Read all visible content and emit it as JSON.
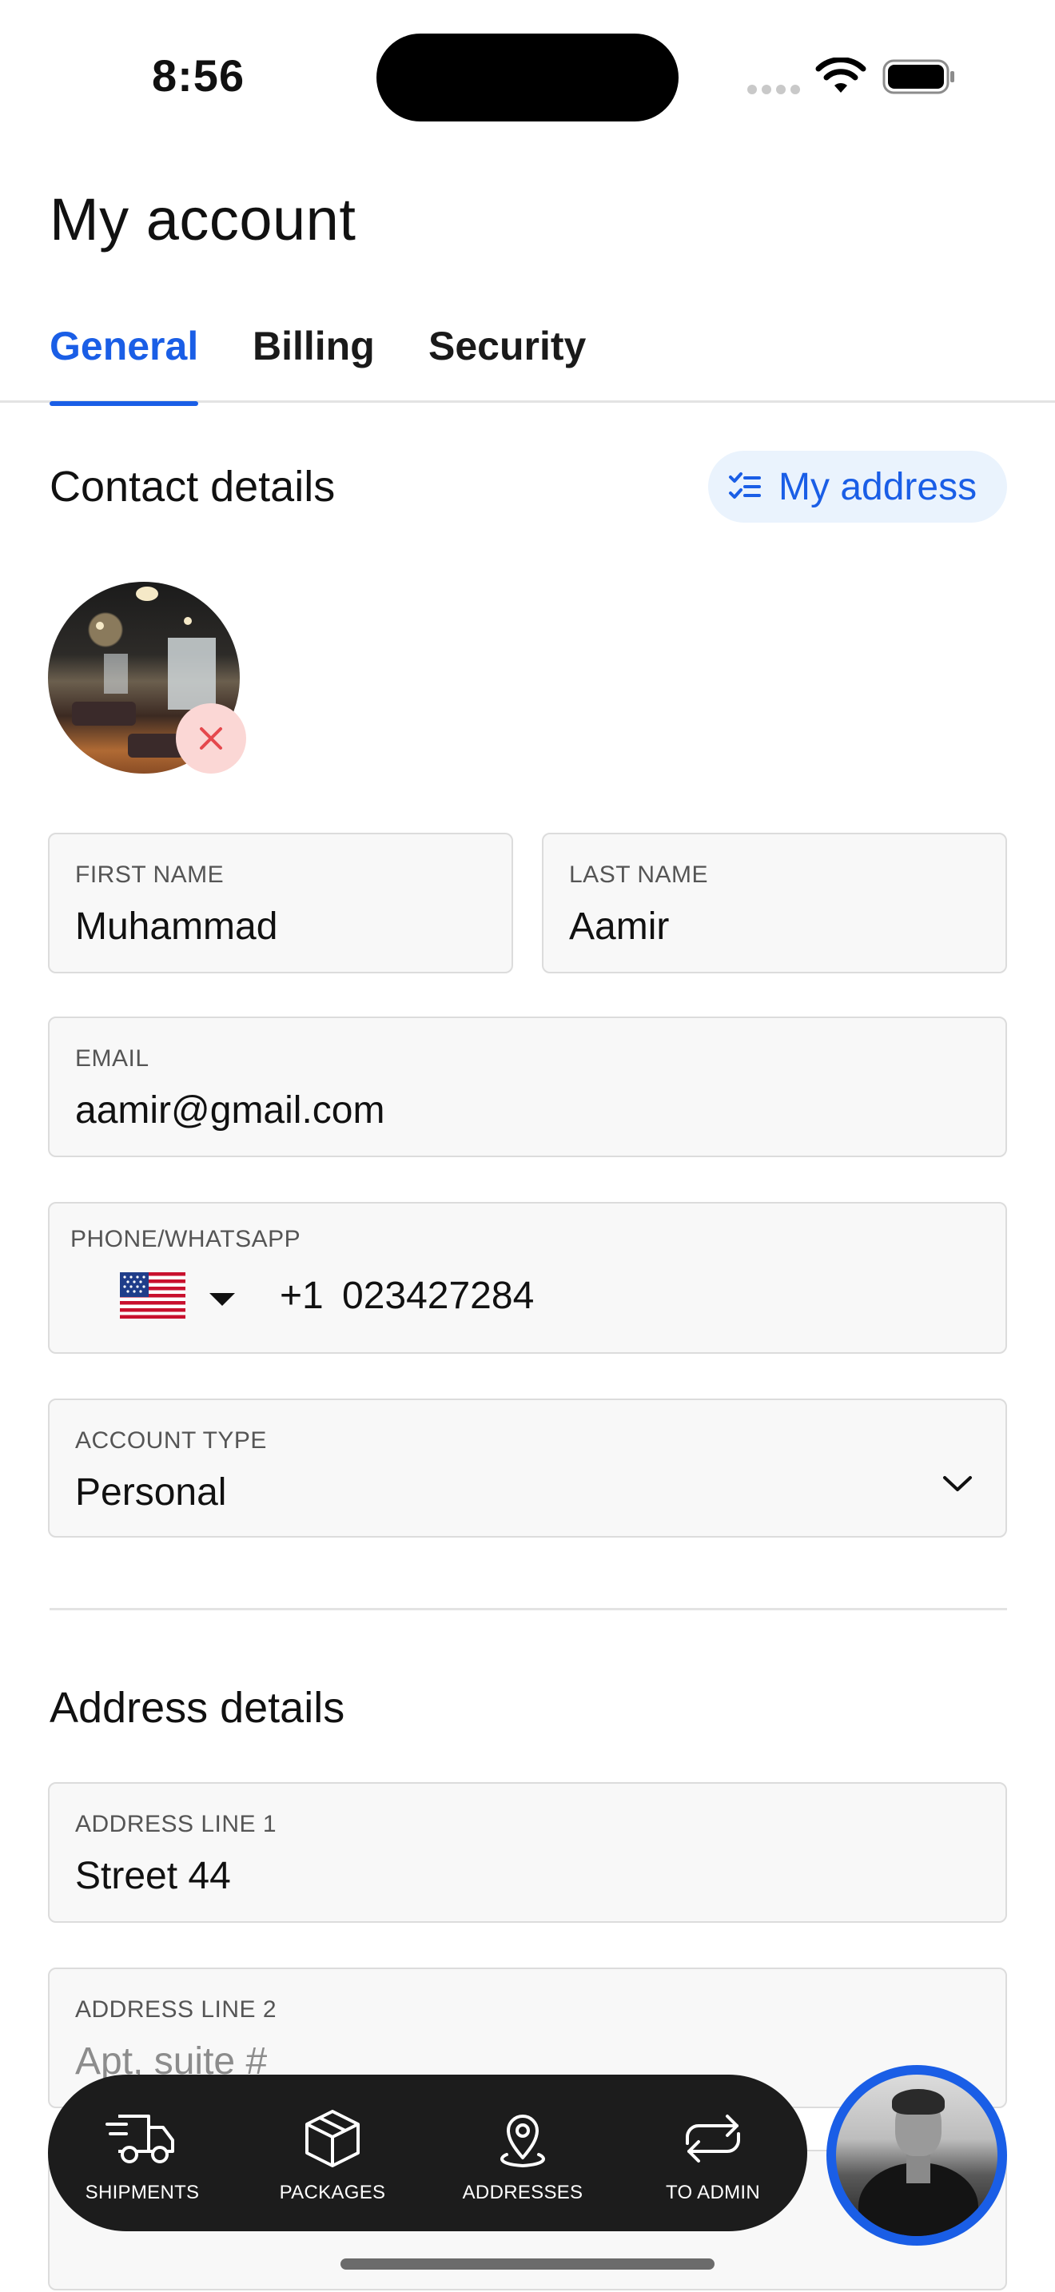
{
  "status_bar": {
    "time": "8:56"
  },
  "header": {
    "title": "My account"
  },
  "tabs": [
    {
      "label": "General",
      "active": true
    },
    {
      "label": "Billing",
      "active": false
    },
    {
      "label": "Security",
      "active": false
    }
  ],
  "contact": {
    "section_title": "Contact details",
    "my_address_label": "My address",
    "first_name": {
      "label": "FIRST NAME",
      "value": "Muhammad"
    },
    "last_name": {
      "label": "LAST NAME",
      "value": "Aamir"
    },
    "email": {
      "label": "EMAIL",
      "value": "aamir@gmail.com"
    },
    "phone": {
      "label": "PHONE/WHATSAPP",
      "country": "US",
      "dial_code": "+1",
      "value": "023427284"
    },
    "account_type": {
      "label": "ACCOUNT TYPE",
      "value": "Personal"
    }
  },
  "address": {
    "section_title": "Address details",
    "line1": {
      "label": "ADDRESS LINE 1",
      "value": "Street 44"
    },
    "line2": {
      "label": "ADDRESS LINE 2",
      "placeholder": "Apt, suite #"
    }
  },
  "bottom_nav": {
    "items": [
      {
        "label": "SHIPMENTS",
        "icon": "truck-icon"
      },
      {
        "label": "PACKAGES",
        "icon": "package-icon"
      },
      {
        "label": "ADDRESSES",
        "icon": "map-pin-icon"
      },
      {
        "label": "TO ADMIN",
        "icon": "switch-arrows-icon"
      }
    ]
  },
  "colors": {
    "accent": "#1a5ee6",
    "accent_soft_bg": "#eaf3fd",
    "remove_bg": "#fbd7d5",
    "remove_icon": "#e5484d",
    "nav_bg": "#1c1c1c",
    "field_bg": "#f8f8f8",
    "field_border": "#dcdcdc"
  }
}
